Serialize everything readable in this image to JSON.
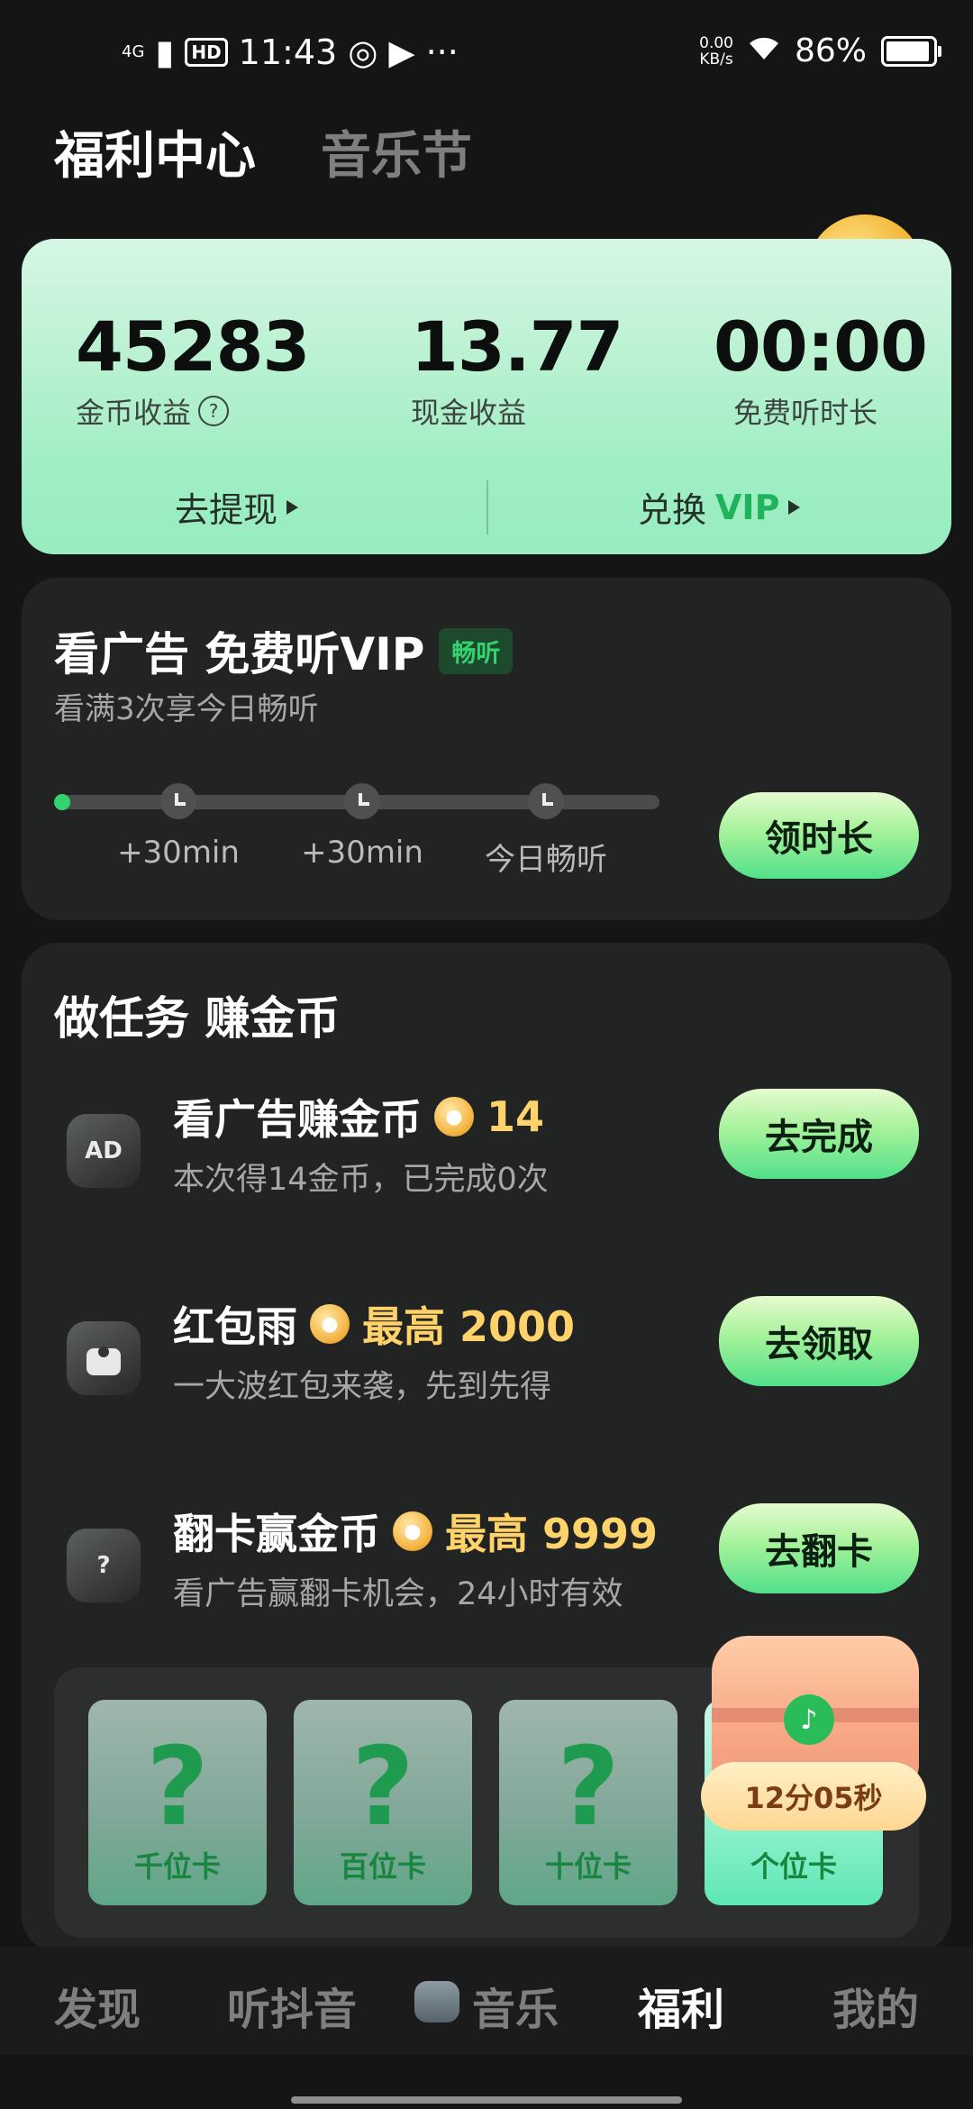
{
  "status_bar": {
    "network": "4G",
    "hd": "HD",
    "time": "11:43",
    "more": "···",
    "speed_value": "0.00",
    "speed_unit": "KB/s",
    "battery": "86%"
  },
  "tabs": [
    {
      "label": "福利中心",
      "active": true
    },
    {
      "label": "音乐节",
      "active": false
    }
  ],
  "earnings": {
    "coins_value": "45283",
    "coins_label": "金币收益",
    "cash_value": "13.77",
    "cash_label": "现金收益",
    "time_value": "00:00",
    "time_label": "免费听时长",
    "withdraw_label": "去提现",
    "exchange_label": "兑换",
    "exchange_vip": "VIP"
  },
  "vip_ad": {
    "title": "看广告 免费听VIP",
    "tag": "畅听",
    "subtitle": "看满3次享今日畅听",
    "milestones": [
      "+30min",
      "+30min",
      "今日畅听"
    ],
    "button": "领时长"
  },
  "tasks": {
    "heading": "做任务 赚金币",
    "items": [
      {
        "icon": "ad-icon",
        "icon_text": "AD",
        "title": "看广告赚金币",
        "reward": "14",
        "desc": "本次得14金币，已完成0次",
        "button": "去完成"
      },
      {
        "icon": "red-packet-icon",
        "icon_text": "",
        "title": "红包雨",
        "reward": "最高 2000",
        "desc": "一大波红包来袭，先到先得",
        "button": "去领取"
      },
      {
        "icon": "flip-card-icon",
        "icon_text": "?",
        "title": "翻卡赢金币",
        "reward": "最高 9999",
        "desc": "看广告赢翻卡机会，24小时有效",
        "button": "去翻卡"
      }
    ],
    "flip_cards": [
      {
        "symbol": "?",
        "label": "千位卡"
      },
      {
        "symbol": "?",
        "label": "百位卡"
      },
      {
        "symbol": "?",
        "label": "十位卡"
      },
      {
        "symbol": "",
        "label": "个位卡"
      }
    ],
    "chest_timer": "12分05秒"
  },
  "bottom_nav": [
    {
      "label": "发现",
      "active": false
    },
    {
      "label": "听抖音",
      "active": false
    },
    {
      "label": "音乐",
      "active": false
    },
    {
      "label": "福利",
      "active": true
    },
    {
      "label": "我的",
      "active": false
    }
  ]
}
